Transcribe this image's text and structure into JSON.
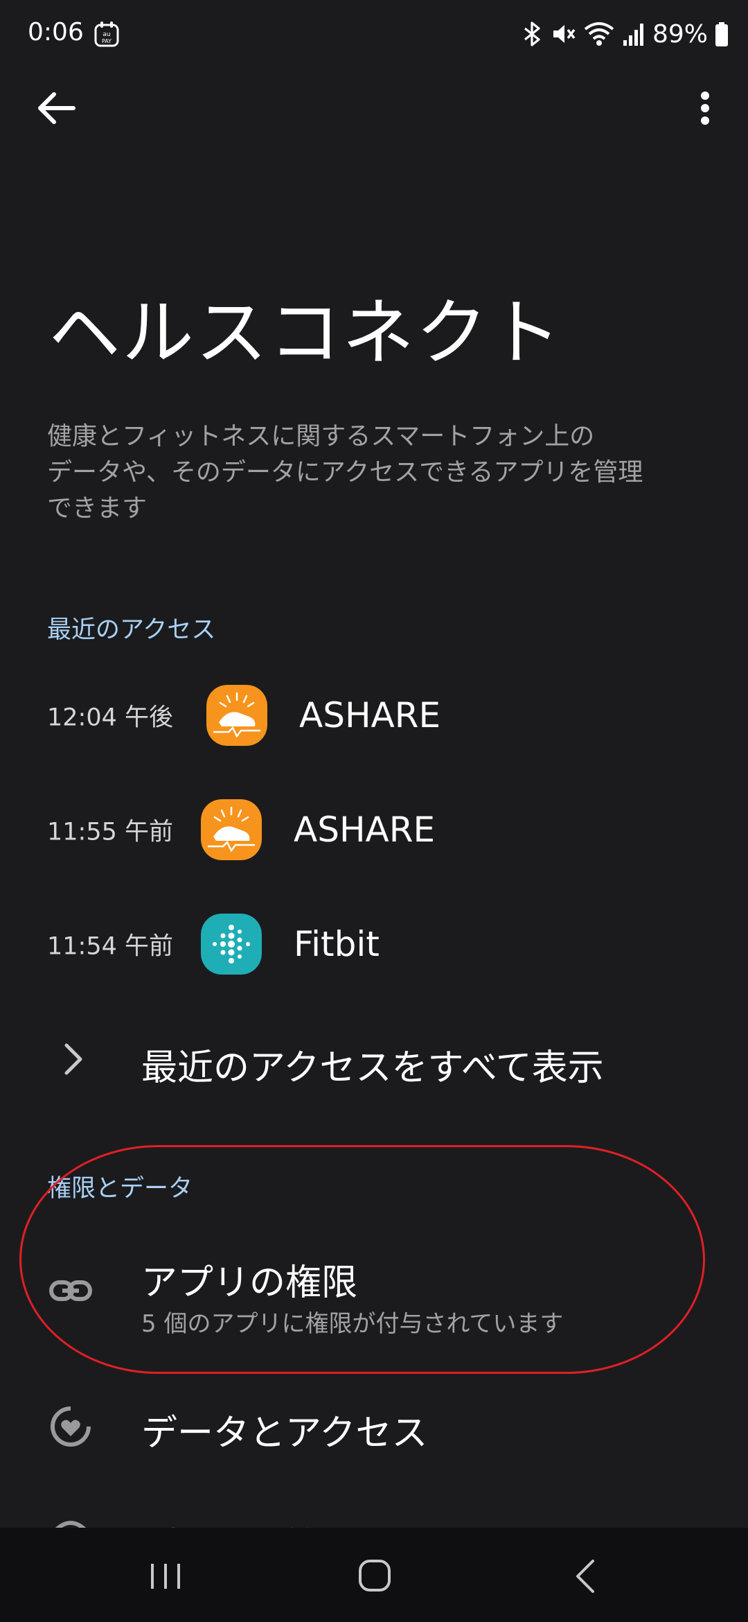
{
  "status_bar": {
    "time": "0:06",
    "pay_badge": "au PAY",
    "battery": "89%",
    "icons": [
      "bluetooth-icon",
      "mute-icon",
      "wifi-icon",
      "signal-icon",
      "battery-icon"
    ]
  },
  "header": {
    "title": "ヘルスコネクト",
    "description": "健康とフィットネスに関するスマートフォン上の\nデータや、そのデータにアクセスできるアプリを管理\nできます"
  },
  "recent_access": {
    "section_title": "最近のアクセス",
    "items": [
      {
        "time": "12:04 午後",
        "app": "ASHARE",
        "icon": "ashare-icon"
      },
      {
        "time": "11:55 午前",
        "app": "ASHARE",
        "icon": "ashare-icon"
      },
      {
        "time": "11:54 午前",
        "app": "Fitbit",
        "icon": "fitbit-icon"
      }
    ],
    "see_all": "最近のアクセスをすべて表示"
  },
  "permissions": {
    "section_title": "権限とデータ",
    "app_permissions": {
      "title": "アプリの権限",
      "subtitle": "5 個のアプリに権限が付与されています"
    },
    "data_access": "データとアクセス",
    "partial_item": "データの管理"
  },
  "colors": {
    "background": "#1b1b1d",
    "section_title": "#a9d0f5",
    "highlight": "#e01f27",
    "ashare": "#f7941d",
    "fitbit": "#1faeb5"
  }
}
